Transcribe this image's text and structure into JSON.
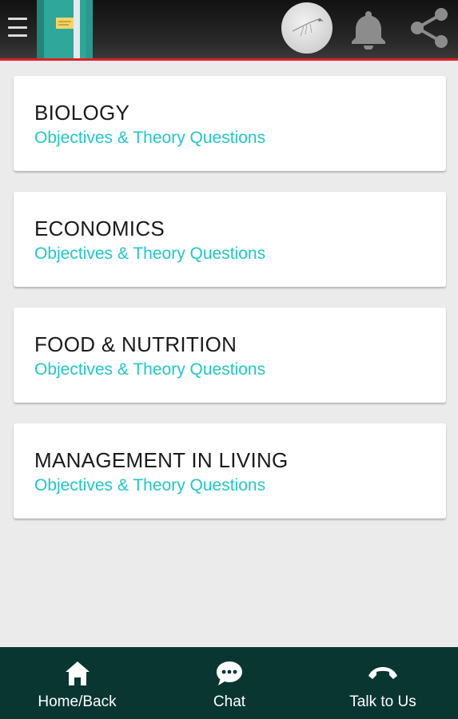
{
  "app_bar": {
    "menu_icon": "hamburger-menu-icon",
    "logo_icon": "notebook-logo-icon",
    "avatar_icon": "profile-avatar-icon",
    "notification_icon": "bell-icon",
    "share_icon": "share-icon",
    "accent_color": "#e01f26"
  },
  "subjects": [
    {
      "title": "BIOLOGY",
      "subtitle": "Objectives & Theory Questions"
    },
    {
      "title": "ECONOMICS",
      "subtitle": "Objectives & Theory Questions"
    },
    {
      "title": "FOOD & NUTRITION",
      "subtitle": "Objectives & Theory Questions"
    },
    {
      "title": "MANAGEMENT IN LIVING",
      "subtitle": "Objectives & Theory Questions"
    }
  ],
  "bottom_nav": {
    "home_label": "Home/Back",
    "chat_label": "Chat",
    "talk_label": "Talk to Us",
    "home_icon": "home-icon",
    "chat_icon": "chat-bubble-icon",
    "talk_icon": "phone-icon",
    "background_color": "#0a3632"
  },
  "colors": {
    "subtitle": "#1fc7c9",
    "background": "#ebebeb"
  }
}
